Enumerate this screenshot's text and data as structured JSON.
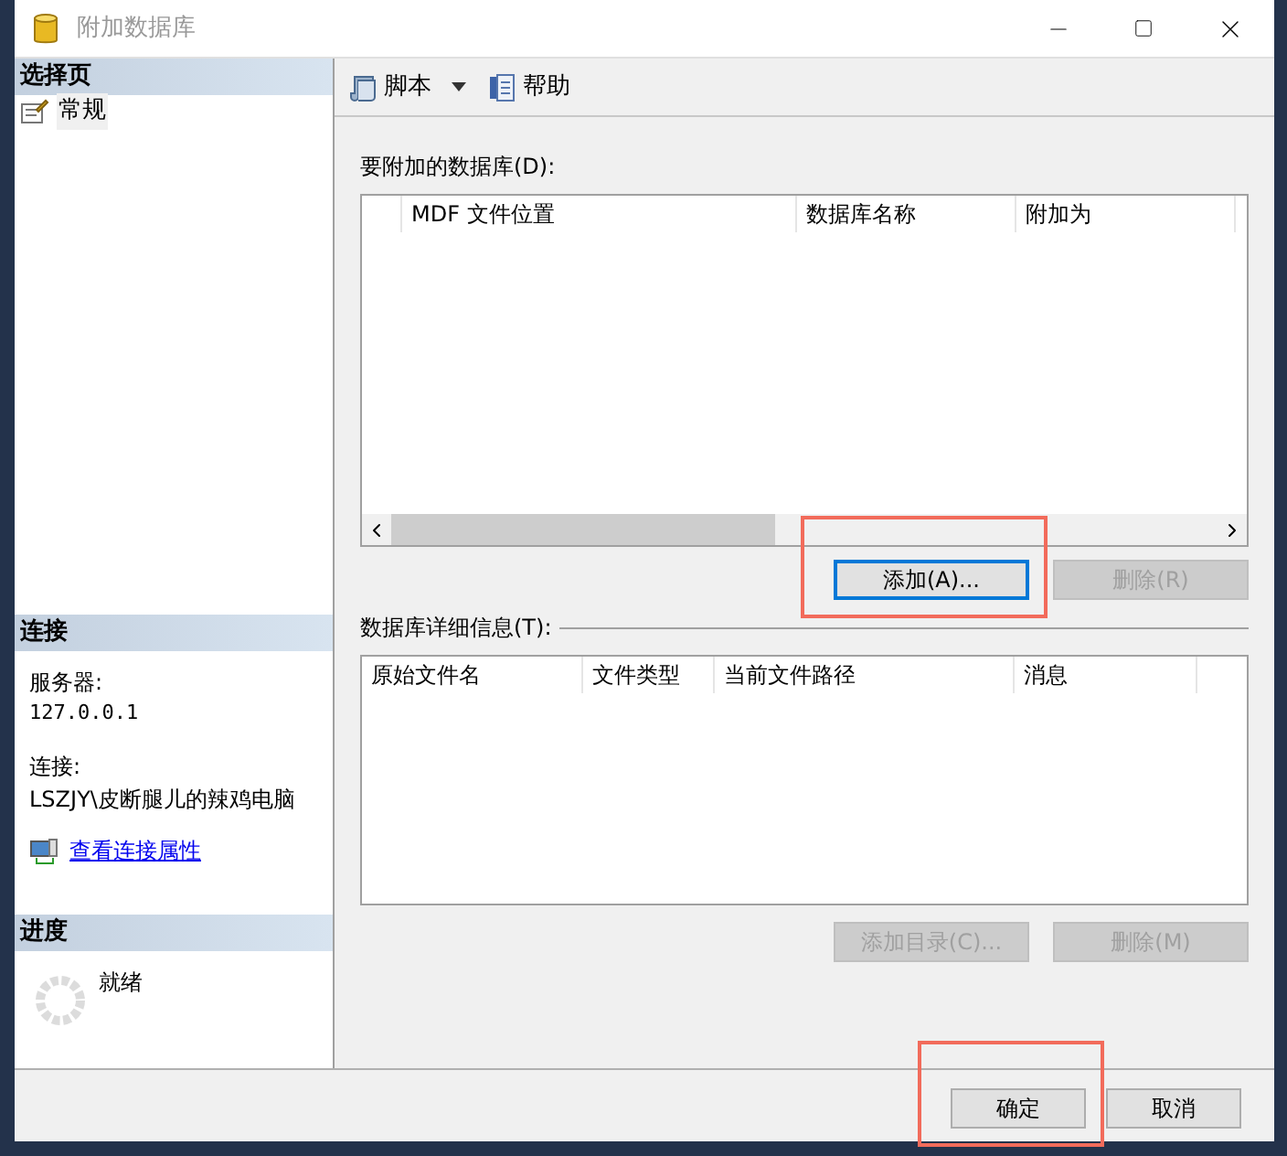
{
  "window": {
    "title": "附加数据库"
  },
  "sidebar": {
    "select_page": {
      "header": "选择页",
      "items": [
        {
          "label": "常规",
          "selected": true
        }
      ]
    },
    "connection": {
      "header": "连接",
      "server_label": "服务器:",
      "server": "127.0.0.1",
      "connection_label": "连接:",
      "connection": "LSZJY\\皮断腿儿的辣鸡电脑",
      "link": "查看连接属性"
    },
    "progress": {
      "header": "进度",
      "status": "就绪"
    }
  },
  "toolbar": {
    "items": [
      {
        "kind": "script",
        "label": "脚本"
      },
      {
        "kind": "help",
        "label": "帮助"
      }
    ]
  },
  "databases": {
    "label": "要附加的数据库(D):",
    "columns": [
      "MDF 文件位置",
      "数据库名称",
      "附加为"
    ],
    "buttons": [
      {
        "label": "添加(A)...",
        "disabled": false,
        "focused": true,
        "highlighted": true
      },
      {
        "label": "删除(R)",
        "disabled": true,
        "focused": false,
        "highlighted": false
      }
    ]
  },
  "details": {
    "label": "数据库详细信息(T):",
    "columns": [
      "原始文件名",
      "文件类型",
      "当前文件路径",
      "消息"
    ],
    "buttons": [
      {
        "label": "添加目录(C)...",
        "disabled": true,
        "focused": false,
        "highlighted": false
      },
      {
        "label": "删除(M)",
        "disabled": true,
        "focused": false,
        "highlighted": false
      }
    ]
  },
  "footer": {
    "buttons": [
      {
        "label": "确定",
        "disabled": false,
        "focused": false,
        "highlighted": true
      },
      {
        "label": "取消",
        "disabled": false,
        "focused": false,
        "highlighted": false
      }
    ]
  }
}
